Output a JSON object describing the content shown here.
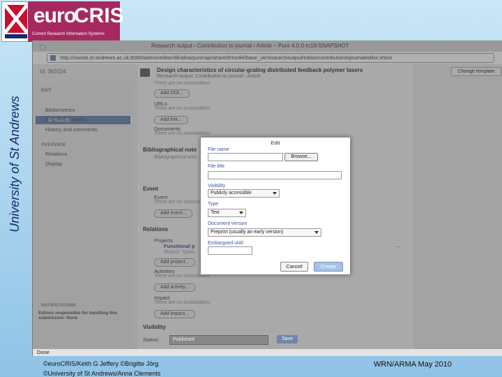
{
  "slide": {
    "logo_euro": "euro",
    "logo_cris": "CRIS",
    "logo_tagline": "Current Research Information Systems",
    "side_text": "University of St Andrews",
    "footer_line1": "©euroCRIS/Keith G Jeffery ©Brigitte Jörg",
    "footer_line2": "©University of St Andrews/Anna Clements",
    "footer_right": "WRN/ARMA May 2010"
  },
  "browser": {
    "window_title": "Research output › Contribution to journal › Article – Pure 4.0.0-rc18-SNAPSHOT",
    "url": "http://risweb.st-andrews.ac.uk:8080/admin/editor/dk/atira/pure/api/shared/model/base_uk/researchoutput/editor/contributiontojournaleditor.xhtml",
    "status": "Done"
  },
  "app": {
    "id_label": "Id: 362034",
    "doc_title": "Design characteristics of circular-grating distributed feedback polymer lasers",
    "doc_subtitle": "Research output: Contribution to journal › Article",
    "change_template": "Change template",
    "nav": {
      "edit_header": "EDIT",
      "items": [
        "Metadata",
        "Bibliometrics",
        "SHERPA RoMEO",
        "History and comments"
      ],
      "overview_header": "OVERVIEW",
      "overview_items": [
        "Relations",
        "Display"
      ],
      "notifications_header": "NOTIFICATIONS",
      "notifications_text": "Editors responsible for handling this submission: None"
    },
    "content": {
      "no_assoc": "There are no associations",
      "add_doi": "Add DOI...",
      "urls": "URLs",
      "add_link": "Add link...",
      "documents": "Documents",
      "biblio_header": "Bibliographical note",
      "biblio_sub": "Bibliographical note",
      "event_header": "Event",
      "event_label": "Event",
      "add_event": "Add event...",
      "relations_header": "Relations",
      "projects": "Projects",
      "project_name": "Functional p",
      "project_type": "Project: Types",
      "add_project": "Add project...",
      "activities": "Activities",
      "add_activity": "Add activity...",
      "impact": "Impact",
      "add_impact": "Add impact...",
      "visibility_header": "Visibility",
      "status_label": "Status:",
      "status_value": "Published",
      "save": "Save",
      "dash": "–"
    }
  },
  "dialog": {
    "title": "Edit",
    "file_name_label": "File name",
    "browse": "Browse...",
    "file_title_label": "File title",
    "visibility_label": "Visibility",
    "visibility_value": "Publicly accessible",
    "type_label": "Type",
    "type_value": "Text",
    "doc_version_label": "Document version",
    "doc_version_value": "Preprint (usually an early version)",
    "embargo_label": "Embargoed until",
    "cancel": "Cancel",
    "create": "Create"
  }
}
